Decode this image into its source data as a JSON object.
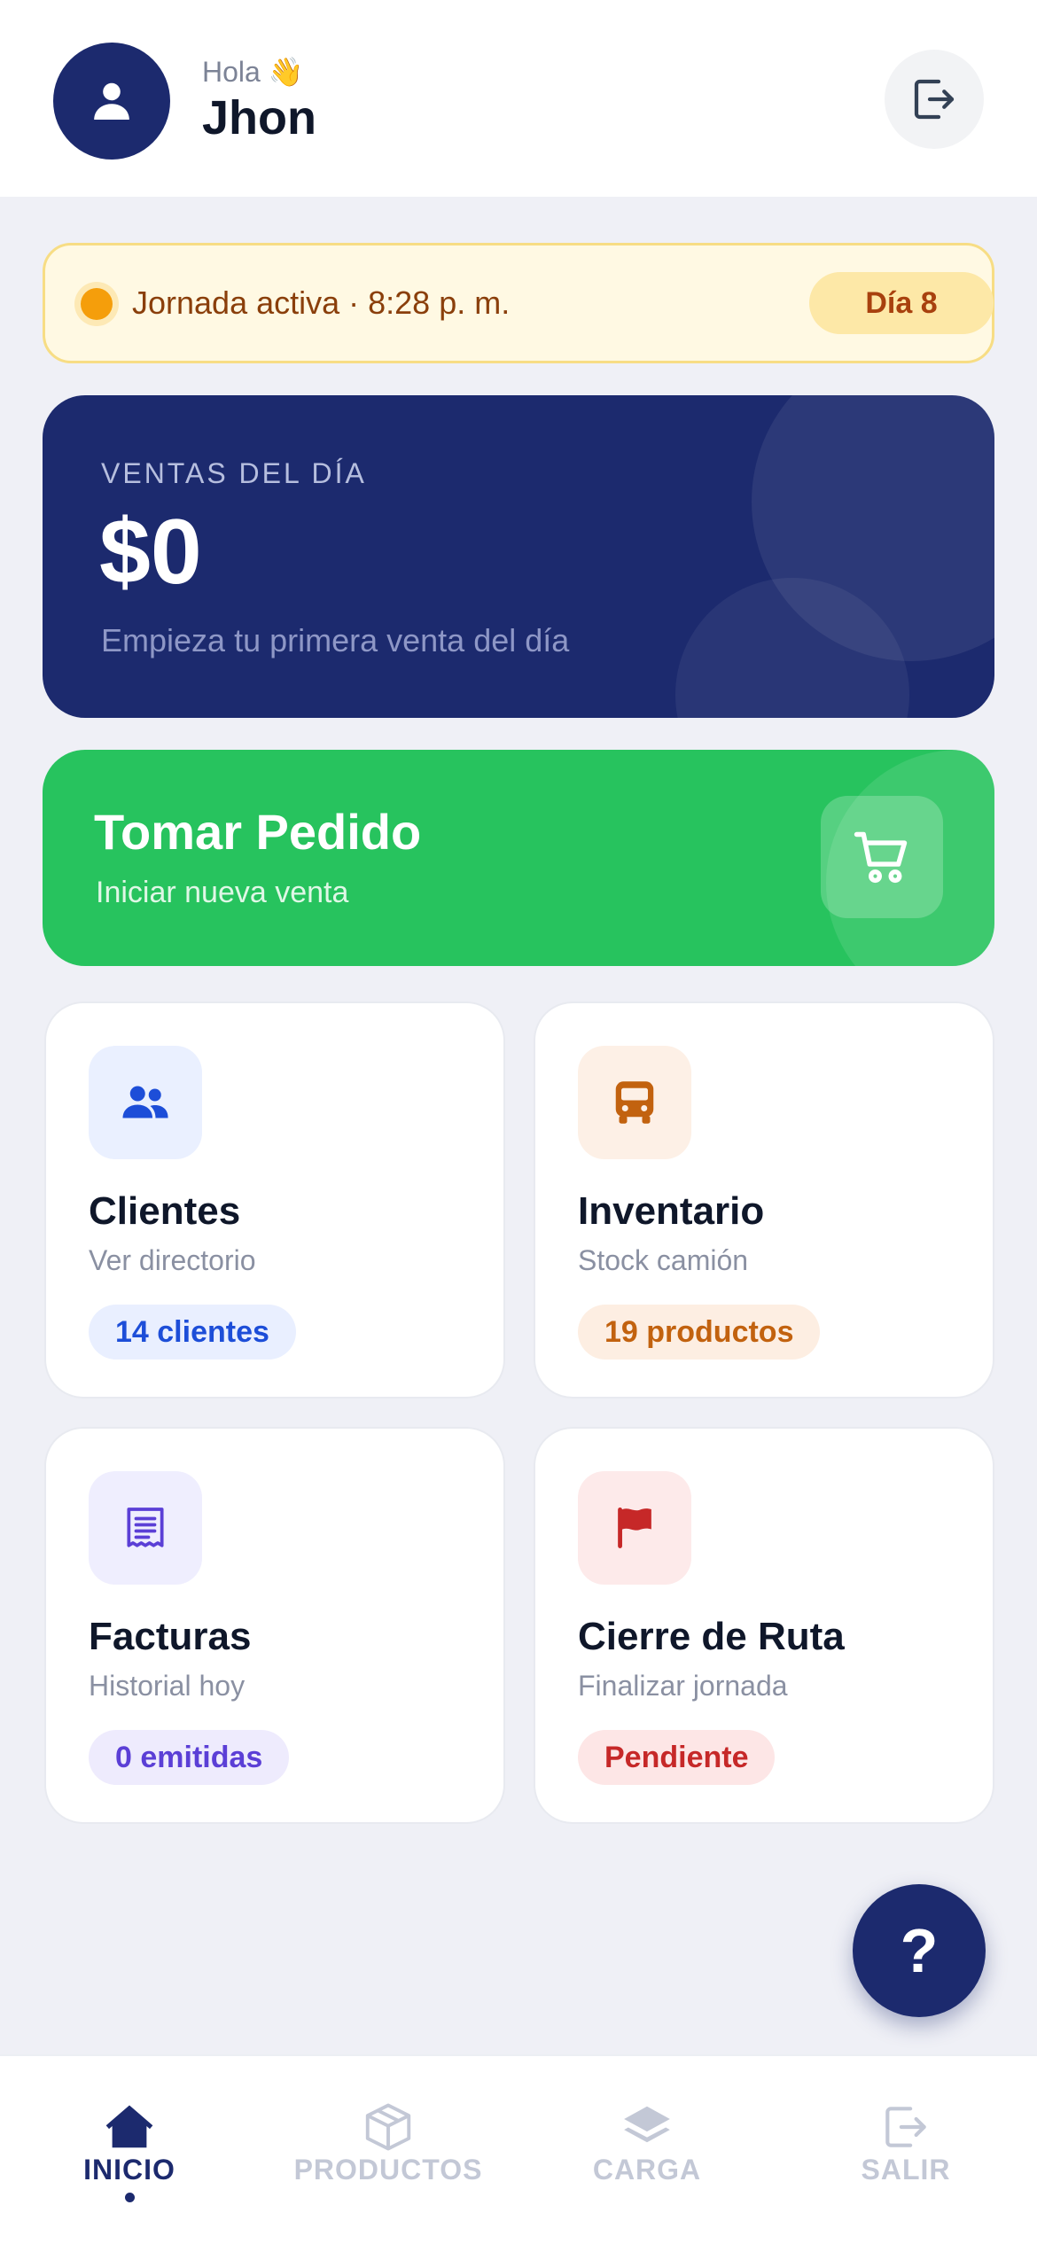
{
  "header": {
    "greeting": "Hola 👋",
    "user_name": "Jhon",
    "avatar_icon": "user-icon",
    "logout_icon": "logout-icon"
  },
  "status": {
    "text": "Jornada activa · 8:28 p. m.",
    "day_badge": "Día 8",
    "dot_color": "#f59e0b"
  },
  "sales": {
    "label": "VENTAS DEL DÍA",
    "amount": "$0",
    "hint": "Empieza tu primera venta del día"
  },
  "order": {
    "title": "Tomar Pedido",
    "subtitle": "Iniciar nueva venta",
    "icon": "cart-icon"
  },
  "cards": [
    {
      "title": "Clientes",
      "subtitle": "Ver directorio",
      "badge": "14 clientes",
      "icon": "users-icon",
      "color": "#1d4ed8",
      "bg": "#eaf0ff"
    },
    {
      "title": "Inventario",
      "subtitle": "Stock camión",
      "badge": "19 productos",
      "icon": "truck-icon",
      "color": "#c2620f",
      "bg": "#fdf0e6"
    },
    {
      "title": "Facturas",
      "subtitle": "Historial hoy",
      "badge": "0 emitidas",
      "icon": "receipt-icon",
      "color": "#5b3fd6",
      "bg": "#efeefe"
    },
    {
      "title": "Cierre de Ruta",
      "subtitle": "Finalizar jornada",
      "badge": "Pendiente",
      "icon": "flag-icon",
      "color": "#c62828",
      "bg": "#fdeaea"
    }
  ],
  "help_button": {
    "label": "?"
  },
  "nav": [
    {
      "label": "INICIO",
      "icon": "home-icon",
      "active": true
    },
    {
      "label": "PRODUCTOS",
      "icon": "box-icon",
      "active": false
    },
    {
      "label": "CARGA",
      "icon": "layers-icon",
      "active": false
    },
    {
      "label": "SALIR",
      "icon": "logout-icon",
      "active": false
    }
  ],
  "colors": {
    "primary": "#1c2a6e",
    "success": "#27c35e",
    "background": "#eff0f6"
  }
}
